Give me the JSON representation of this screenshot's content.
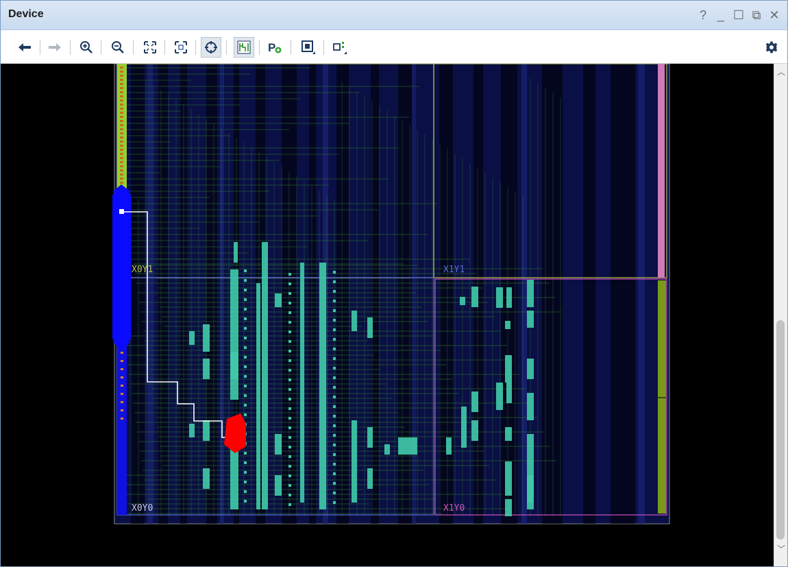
{
  "window": {
    "title": "Device"
  },
  "window_controls": [
    {
      "name": "help-icon",
      "glyph": "?"
    },
    {
      "name": "minimize-icon",
      "glyph": "_"
    },
    {
      "name": "maximize-icon",
      "glyph": "☐"
    },
    {
      "name": "restore-icon",
      "glyph": "⧉"
    },
    {
      "name": "close-icon",
      "glyph": "✕"
    }
  ],
  "toolbar": {
    "buttons": [
      {
        "name": "back-button",
        "icon": "arrow-left-icon"
      },
      {
        "name": "forward-button",
        "icon": "arrow-right-icon"
      },
      {
        "name": "zoom-in-button",
        "icon": "zoom-in-icon"
      },
      {
        "name": "zoom-out-button",
        "icon": "zoom-out-icon"
      },
      {
        "name": "zoom-fit-button",
        "icon": "fit-icon"
      },
      {
        "name": "zoom-selected-button",
        "icon": "zoom-selected-icon"
      },
      {
        "name": "auto-fit-selection-button",
        "icon": "crosshair-icon",
        "active": true
      },
      {
        "name": "routing-resources-button",
        "icon": "routing-icon",
        "active": true
      },
      {
        "name": "create-pblock-button",
        "icon": "pblock-add-icon",
        "text": "P"
      },
      {
        "name": "draw-pblock-button",
        "icon": "rectangle-icon"
      },
      {
        "name": "highlight-button",
        "icon": "highlight-icon"
      }
    ],
    "settings_icon": "gear-icon"
  },
  "device_view": {
    "clock_regions": [
      {
        "label": "X0Y1",
        "color": "#b7c24a"
      },
      {
        "label": "X1Y1",
        "color": "#5a6ad8"
      },
      {
        "label": "X0Y0",
        "color": "#c8c8f0"
      },
      {
        "label": "X1Y0",
        "color": "#d050c0"
      }
    ],
    "colors": {
      "background": "#000000",
      "fabric": "#0a0f45",
      "routing": "#2e7a2e",
      "cells": "#40c8a8",
      "io_bank_left": "#1010e0",
      "selected_blue": "#0a0aff",
      "selected_red": "#ff0000",
      "route": "#ffffff",
      "right_column_pink": "#d07ab8",
      "right_column_green": "#7a9a1a"
    }
  }
}
